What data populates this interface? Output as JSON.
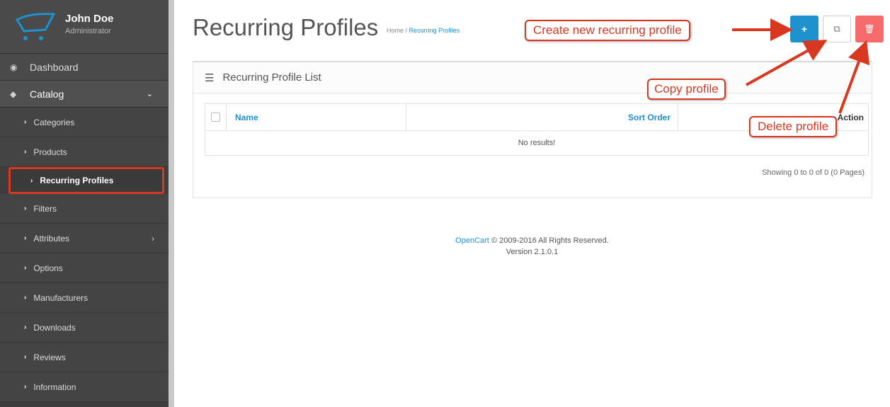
{
  "user": {
    "name": "John Doe",
    "role": "Administrator"
  },
  "sidebar": {
    "items": [
      {
        "label": "Dashboard",
        "icon": "dashboard-icon"
      },
      {
        "label": "Catalog",
        "icon": "tag-icon"
      }
    ],
    "sub_items": [
      {
        "label": "Categories"
      },
      {
        "label": "Products"
      },
      {
        "label": "Recurring Profiles"
      },
      {
        "label": "Filters"
      },
      {
        "label": "Attributes"
      },
      {
        "label": "Options"
      },
      {
        "label": "Manufacturers"
      },
      {
        "label": "Downloads"
      },
      {
        "label": "Reviews"
      },
      {
        "label": "Information"
      }
    ]
  },
  "header": {
    "title": "Recurring Profiles",
    "breadcrumb": {
      "home": "Home",
      "separator": "/",
      "current": "Recurring Profiles"
    },
    "buttons": {
      "add": "+",
      "copy": "⧉",
      "delete": "🗑"
    }
  },
  "panel": {
    "title": "Recurring Profile List",
    "columns": {
      "name": "Name",
      "sort_order": "Sort Order",
      "action": "Action"
    },
    "empty_text": "No results!",
    "pagination": "Showing 0 to 0 of 0 (0 Pages)"
  },
  "footer": {
    "brand": "OpenCart",
    "copyright": "© 2009-2016 All Rights Reserved.",
    "version": "Version 2.1.0.1"
  },
  "annotations": {
    "create": "Create new recurring profile",
    "copy": "Copy profile",
    "delete": "Delete profile"
  },
  "colors": {
    "primary": "#1e91cf",
    "danger": "#f56b6b",
    "annotation": "#d8381f",
    "sidebar": "#3d3d3d"
  }
}
